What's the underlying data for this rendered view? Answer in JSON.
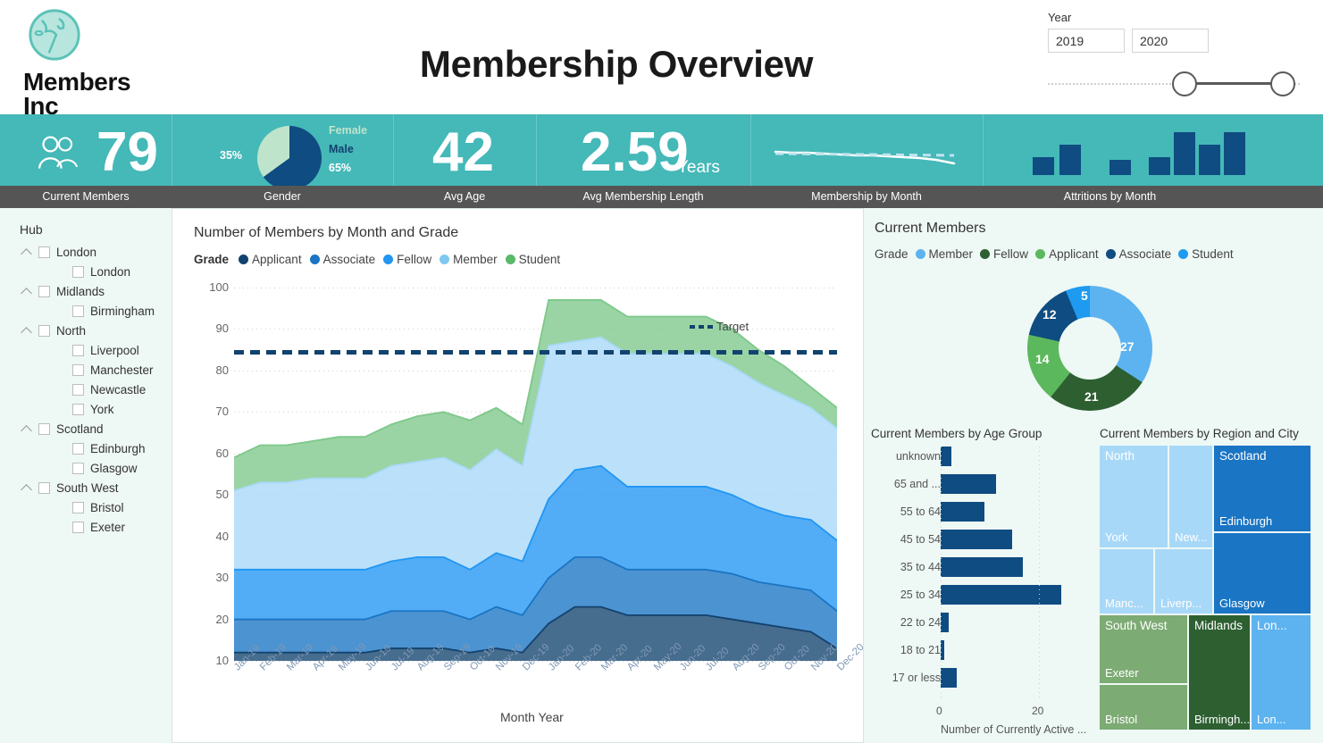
{
  "header": {
    "logo_line1": "Members",
    "logo_line2": "Inc",
    "logo_icon": "globe-icon",
    "title": "Membership Overview",
    "year_slicer": {
      "label": "Year",
      "from": "2019",
      "to": "2020"
    }
  },
  "kpis": [
    {
      "caption": "Current Members",
      "value": "79",
      "icon": "people-icon"
    },
    {
      "caption": "Gender",
      "female_pct": "35%",
      "male_pct": "65%",
      "female_label": "Female",
      "male_label": "Male"
    },
    {
      "caption": "Avg Age",
      "value": "42"
    },
    {
      "caption": "Avg Membership Length",
      "value": "2.59",
      "unit": "Years"
    },
    {
      "caption": "Membership by Month"
    },
    {
      "caption": "Attritions by Month"
    }
  ],
  "kpi_colors": {
    "banner": "#45b8b8",
    "strip": "#555555",
    "female": "#bfe4cc",
    "male": "#0f4c81",
    "bar": "#0f4c81"
  },
  "attritions_by_month": [
    3,
    6,
    0,
    2.5,
    3.5,
    9,
    6,
    9
  ],
  "sidebar": {
    "title": "Hub",
    "items": [
      {
        "label": "London",
        "level": 1,
        "expandable": true
      },
      {
        "label": "London",
        "level": 2,
        "expandable": false
      },
      {
        "label": "Midlands",
        "level": 1,
        "expandable": true
      },
      {
        "label": "Birmingham",
        "level": 2,
        "expandable": false
      },
      {
        "label": "North",
        "level": 1,
        "expandable": true
      },
      {
        "label": "Liverpool",
        "level": 2,
        "expandable": false
      },
      {
        "label": "Manchester",
        "level": 2,
        "expandable": false
      },
      {
        "label": "Newcastle",
        "level": 2,
        "expandable": false
      },
      {
        "label": "York",
        "level": 2,
        "expandable": false
      },
      {
        "label": "Scotland",
        "level": 1,
        "expandable": true
      },
      {
        "label": "Edinburgh",
        "level": 2,
        "expandable": false
      },
      {
        "label": "Glasgow",
        "level": 2,
        "expandable": false
      },
      {
        "label": "South West",
        "level": 1,
        "expandable": true
      },
      {
        "label": "Bristol",
        "level": 2,
        "expandable": false
      },
      {
        "label": "Exeter",
        "level": 2,
        "expandable": false
      }
    ]
  },
  "area_chart": {
    "title": "Number of Members by Month and Grade",
    "legend_title": "Grade",
    "target_label": "Target"
  },
  "donut_panel": {
    "title": "Current Members",
    "legend_title": "Grade"
  },
  "age_chart": {
    "title": "Current Members by Age Group",
    "xlabel": "Number of Currently Active ..."
  },
  "treemap": {
    "title": "Current Members by Region and City"
  },
  "chart_data": [
    {
      "type": "area",
      "id": "members-by-month-and-grade",
      "title": "Number of Members by Month and Grade",
      "xlabel": "Month Year",
      "ylabel": "",
      "ylim": [
        10,
        100
      ],
      "yticks": [
        10,
        20,
        30,
        40,
        50,
        60,
        70,
        80,
        90,
        100
      ],
      "grid": true,
      "legend_position": "top",
      "legend_title": "Grade",
      "stacked": true,
      "target": {
        "label": "Target",
        "value": 85,
        "style": "dashed",
        "color": "#12426e"
      },
      "categories": [
        "Jan-19",
        "Feb-19",
        "Mar-19",
        "Apr-19",
        "May-19",
        "Jun-19",
        "Jul-19",
        "Aug-19",
        "Sep-19",
        "Oct-19",
        "Nov-19",
        "Dec-19",
        "Jan-20",
        "Feb-20",
        "Mar-20",
        "Apr-20",
        "May-20",
        "Jun-20",
        "Jul-20",
        "Aug-20",
        "Sep-20",
        "Oct-20",
        "Nov-20",
        "Dec-20"
      ],
      "series": [
        {
          "name": "Applicant",
          "color": "#12426e",
          "values": [
            12,
            12,
            12,
            12,
            12,
            12,
            13,
            13,
            13,
            12,
            13,
            12,
            19,
            23,
            23,
            21,
            21,
            21,
            21,
            20,
            19,
            18,
            17,
            13
          ]
        },
        {
          "name": "Associate",
          "color": "#1a75c4",
          "values": [
            8,
            8,
            8,
            8,
            8,
            8,
            9,
            9,
            9,
            8,
            10,
            9,
            11,
            12,
            12,
            11,
            11,
            11,
            11,
            11,
            10,
            10,
            10,
            9
          ]
        },
        {
          "name": "Fellow",
          "color": "#2196f3",
          "values": [
            12,
            12,
            12,
            12,
            12,
            12,
            12,
            13,
            13,
            12,
            13,
            13,
            19,
            21,
            22,
            20,
            20,
            20,
            20,
            19,
            18,
            17,
            17,
            17
          ]
        },
        {
          "name": "Member",
          "color": "#a8d8f8",
          "values": [
            19,
            21,
            21,
            22,
            22,
            22,
            23,
            23,
            24,
            24,
            25,
            23,
            37,
            31,
            31,
            32,
            32,
            32,
            32,
            31,
            30,
            29,
            27,
            27
          ]
        },
        {
          "name": "Student",
          "color": "#7dc88a",
          "values": [
            8,
            9,
            9,
            9,
            10,
            10,
            10,
            11,
            11,
            12,
            10,
            10,
            11,
            10,
            9,
            9,
            9,
            9,
            9,
            9,
            8,
            7,
            5,
            5
          ]
        }
      ]
    },
    {
      "type": "pie",
      "id": "gender-kpi",
      "title": "Gender",
      "labels": [
        "Female",
        "Male"
      ],
      "values": [
        35,
        65
      ],
      "value_labels": [
        "35%",
        "65%"
      ],
      "colors": [
        "#bfe4cc",
        "#0f4c81"
      ]
    },
    {
      "type": "bar",
      "id": "attritions-by-month",
      "title": "Attritions by Month",
      "categories": [
        "1",
        "2",
        "3",
        "4",
        "5",
        "6",
        "7",
        "8"
      ],
      "values": [
        3,
        6,
        0,
        2.5,
        3.5,
        9,
        6,
        9
      ],
      "colors": [
        "#0f4c81"
      ]
    },
    {
      "type": "line",
      "id": "membership-by-month",
      "title": "Membership by Month",
      "values": [
        79,
        78,
        78,
        77,
        77,
        76,
        76,
        75,
        75,
        74,
        73,
        72
      ],
      "colors": [
        "#ffffff"
      ]
    },
    {
      "type": "pie",
      "id": "current-members-by-grade",
      "title": "Current Members",
      "subtype": "donut",
      "legend_title": "Grade",
      "labels": [
        "Member",
        "Fellow",
        "Applicant",
        "Associate",
        "Student"
      ],
      "values": [
        27,
        21,
        14,
        12,
        5
      ],
      "colors": [
        "#5cb3f0",
        "#2d5f31",
        "#5cb85c",
        "#0f4c81",
        "#1e9bf0"
      ]
    },
    {
      "type": "bar",
      "id": "current-members-by-age-group",
      "title": "Current Members by Age Group",
      "orientation": "horizontal",
      "xlabel": "Number of Currently Active ...",
      "xlim": [
        0,
        26
      ],
      "xticks": [
        0,
        20
      ],
      "categories": [
        "unknown",
        "65 and ...",
        "55 to 64",
        "45 to 54",
        "35 to 44",
        "25 to 34",
        "22 to 24",
        "18 to 21",
        "17 or less"
      ],
      "values": [
        2,
        10,
        8,
        13,
        15,
        22,
        1.5,
        0.7,
        3
      ],
      "colors": [
        "#0f4c81"
      ]
    },
    {
      "type": "treemap",
      "id": "current-members-by-region-and-city",
      "title": "Current Members by Region and City",
      "groups": [
        {
          "region": "North",
          "color": "#a8d8f8",
          "cities": [
            {
              "name": "York",
              "label": "York"
            },
            {
              "name": "Newcastle",
              "label": "New..."
            },
            {
              "name": "Manchester",
              "label": "Manc..."
            },
            {
              "name": "Liverpool",
              "label": "Liverp..."
            }
          ]
        },
        {
          "region": "Scotland",
          "color": "#1a75c4",
          "cities": [
            {
              "name": "Edinburgh",
              "label": "Edinburgh"
            },
            {
              "name": "Glasgow",
              "label": "Glasgow"
            }
          ]
        },
        {
          "region": "South West",
          "color": "#7dab74",
          "cities": [
            {
              "name": "Exeter",
              "label": "Exeter"
            },
            {
              "name": "Bristol",
              "label": "Bristol"
            }
          ]
        },
        {
          "region": "Midlands",
          "color": "#2d5f31",
          "cities": [
            {
              "name": "Birmingham",
              "label": "Birmingh..."
            }
          ]
        },
        {
          "region": "London",
          "color": "#5cb3f0",
          "cities": [
            {
              "name": "London",
              "label": "Lon..."
            },
            {
              "name": "London",
              "label": "Lon..."
            }
          ]
        }
      ]
    }
  ]
}
